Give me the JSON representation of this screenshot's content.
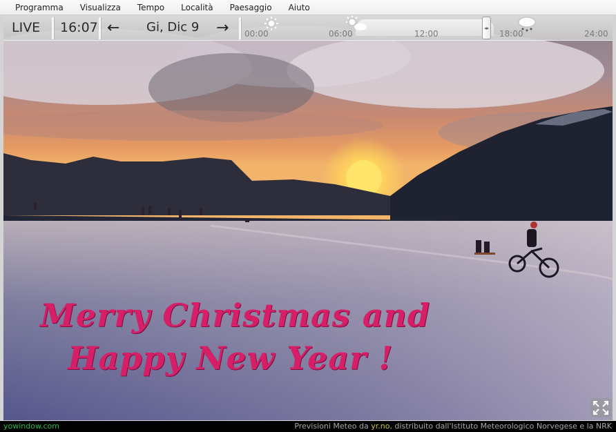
{
  "menu": {
    "items": [
      "Programma",
      "Visualizza",
      "Tempo",
      "Località",
      "Paesaggio",
      "Aiuto"
    ]
  },
  "controls": {
    "live_label": "LIVE",
    "time": "16:07",
    "date": "Gi, Dic 9",
    "prev_arrow": "←",
    "next_arrow": "→"
  },
  "timeline": {
    "ticks": [
      "00:00",
      "06:00",
      "12:00",
      "18:00",
      "24:00"
    ],
    "icons": [
      "sun-icon",
      "partly-cloudy-icon",
      "snow-cloud-icon"
    ]
  },
  "greeting": {
    "line1": "Merry Christmas and",
    "line2": "Happy New Year !"
  },
  "status": {
    "site": "yowindow.com",
    "credit_prefix": "Previsioni Meteo da ",
    "credit_link": "yr.no",
    "credit_suffix": ", distribuito dall'Istituto Meteorologico Norvegese e la NRK"
  },
  "colors": {
    "greeting": "#d61f66",
    "site_link": "#2db84a",
    "credit_link": "#c9c93a"
  }
}
